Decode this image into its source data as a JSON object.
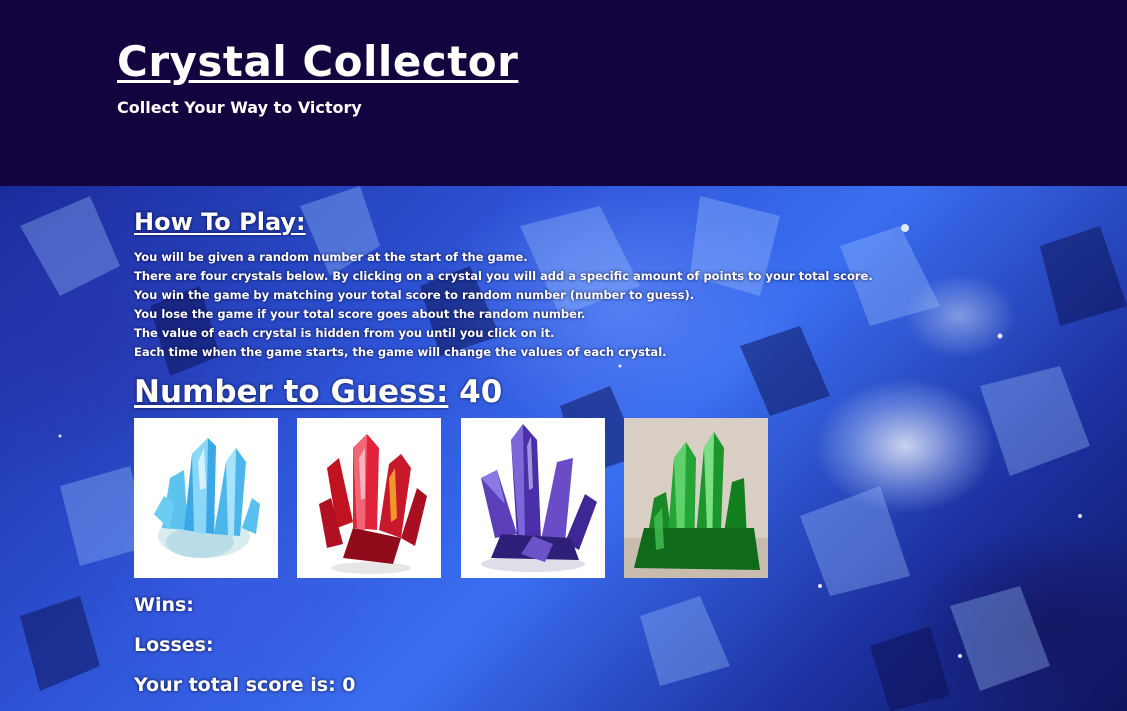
{
  "header": {
    "title": "Crystal Collector",
    "subtitle": "Collect Your Way to Victory"
  },
  "instructions": {
    "heading": "How To Play:",
    "lines": [
      "You will be given a random number at the start of the game.",
      "There are four crystals below. By clicking on a crystal you will add a specific amount of points to your total score.",
      "You win the game by matching your total score to random number (number to guess).",
      "You lose the game if your total score goes about the random number.",
      "The value of each crystal is hidden from you until you click on it.",
      "Each time when the game starts, the game will change the values of each crystal."
    ]
  },
  "game": {
    "number_label": "Number to Guess:",
    "number_value": "40",
    "crystals": [
      {
        "name": "blue-crystal",
        "color": "#4fb8f0"
      },
      {
        "name": "red-crystal",
        "color": "#d0162a"
      },
      {
        "name": "purple-crystal",
        "color": "#5a3fb8"
      },
      {
        "name": "green-crystal",
        "color": "#1f9a2e"
      }
    ]
  },
  "stats": {
    "wins_label": "Wins:",
    "wins_value": "",
    "losses_label": "Losses:",
    "losses_value": "",
    "score_label": "Your total score is:",
    "score_value": "0"
  }
}
